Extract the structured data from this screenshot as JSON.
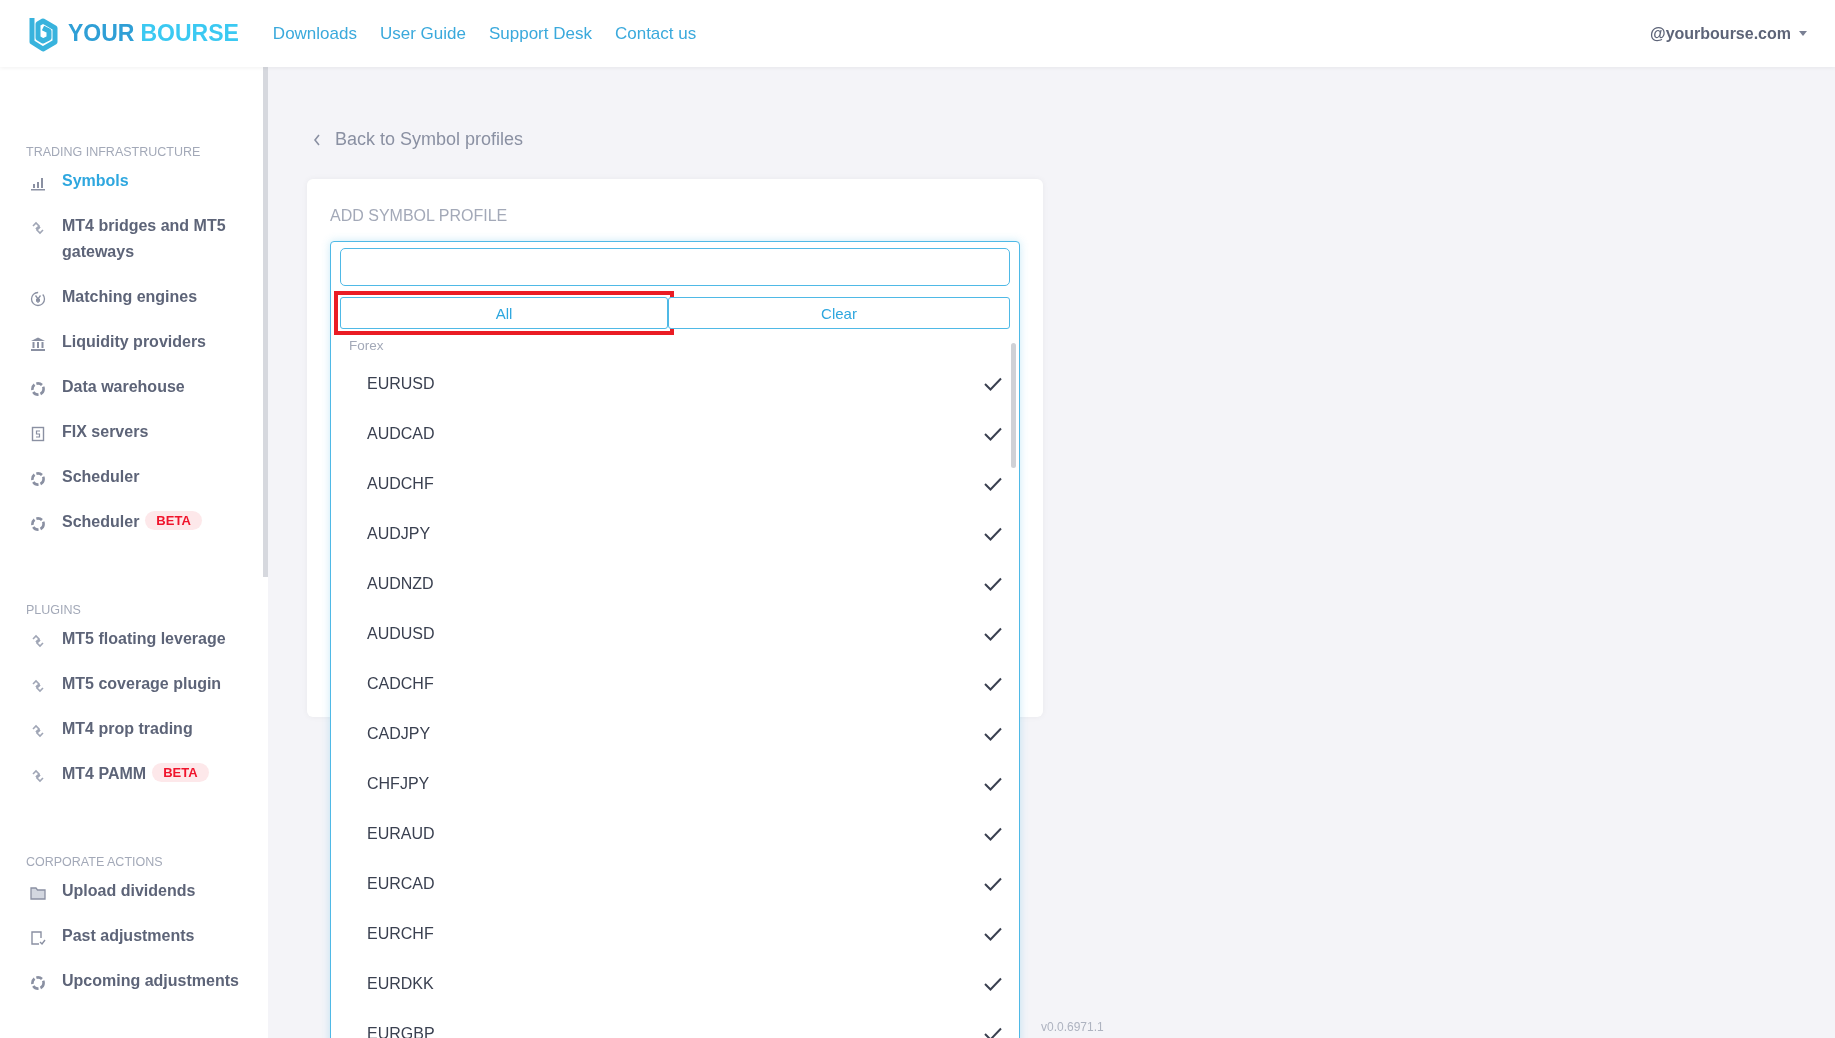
{
  "header": {
    "logo": {
      "first": "YOUR",
      "second": "BOURSE"
    },
    "nav": [
      "Downloads",
      "User Guide",
      "Support Desk",
      "Contact us"
    ],
    "user": "@yourbourse.com"
  },
  "sidebar": {
    "sections": [
      {
        "title": "TRADING INFRASTRUCTURE",
        "items": [
          {
            "label": "Symbols",
            "kind": "bars",
            "selected": true
          },
          {
            "label": "MT4 bridges and MT5 gateways",
            "kind": "link",
            "selected": false
          },
          {
            "label": "Matching engines",
            "kind": "yen",
            "selected": false
          },
          {
            "label": "Liquidity providers",
            "kind": "bank",
            "selected": false
          },
          {
            "label": "Data warehouse",
            "kind": "ring",
            "selected": false
          },
          {
            "label": "FIX servers",
            "kind": "doc",
            "selected": false
          },
          {
            "label": "Scheduler",
            "kind": "ring",
            "selected": false
          },
          {
            "label": "Scheduler",
            "kind": "ring",
            "selected": false,
            "badge": "BETA"
          }
        ]
      },
      {
        "title": "PLUGINS",
        "items": [
          {
            "label": "MT5 floating leverage",
            "kind": "link",
            "selected": false
          },
          {
            "label": "MT5 coverage plugin",
            "kind": "link",
            "selected": false
          },
          {
            "label": "MT4 prop trading",
            "kind": "link",
            "selected": false
          },
          {
            "label": "MT4 PAMM",
            "kind": "link",
            "selected": false,
            "badge": "BETA"
          }
        ]
      },
      {
        "title": "CORPORATE ACTIONS",
        "items": [
          {
            "label": "Upload dividends",
            "kind": "folder",
            "selected": false
          },
          {
            "label": "Past adjustments",
            "kind": "doccheck",
            "selected": false
          },
          {
            "label": "Upcoming adjustments",
            "kind": "ring",
            "selected": false
          }
        ]
      }
    ]
  },
  "back_link": "Back to Symbol profiles",
  "card": {
    "title": "ADD SYMBOL PROFILE",
    "dropdown": {
      "buttons": [
        {
          "label": "All",
          "highlighted": true
        },
        {
          "label": "Clear",
          "highlighted": false
        }
      ],
      "group": "Forex",
      "options": [
        {
          "label": "EURUSD",
          "checked": true
        },
        {
          "label": "AUDCAD",
          "checked": true
        },
        {
          "label": "AUDCHF",
          "checked": true
        },
        {
          "label": "AUDJPY",
          "checked": true
        },
        {
          "label": "AUDNZD",
          "checked": true
        },
        {
          "label": "AUDUSD",
          "checked": true
        },
        {
          "label": "CADCHF",
          "checked": true
        },
        {
          "label": "CADJPY",
          "checked": true
        },
        {
          "label": "CHFJPY",
          "checked": true
        },
        {
          "label": "EURAUD",
          "checked": true
        },
        {
          "label": "EURCAD",
          "checked": true
        },
        {
          "label": "EURCHF",
          "checked": true
        },
        {
          "label": "EURDKK",
          "checked": true
        },
        {
          "label": "EURGBP",
          "checked": true
        }
      ]
    }
  },
  "version": "v0.0.6971.1"
}
